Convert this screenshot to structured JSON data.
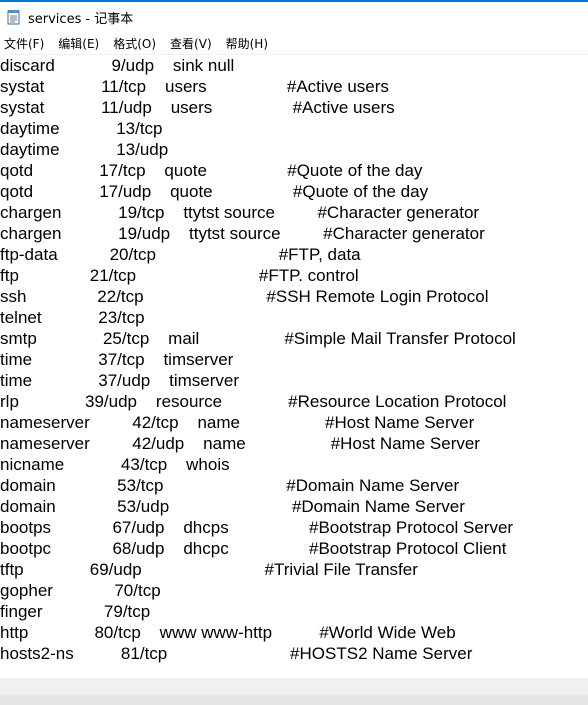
{
  "window": {
    "title": "services - 记事本"
  },
  "menu": {
    "file": "文件(F)",
    "edit": "编辑(E)",
    "format": "格式(O)",
    "view": "查看(V)",
    "help": "帮助(H)"
  },
  "icons": {
    "app": "notepad-icon"
  },
  "editor": {
    "lines": [
      "discard            9/udp    sink null",
      "systat            11/tcp    users                 #Active users",
      "systat            11/udp    users                 #Active users",
      "daytime            13/tcp",
      "daytime            13/udp",
      "qotd              17/tcp    quote                 #Quote of the day",
      "qotd              17/udp    quote                 #Quote of the day",
      "chargen            19/tcp    ttytst source         #Character generator",
      "chargen            19/udp    ttytst source         #Character generator",
      "ftp-data           20/tcp                          #FTP, data",
      "ftp               21/tcp                          #FTP. control",
      "ssh               22/tcp                          #SSH Remote Login Protocol",
      "telnet            23/tcp",
      "smtp              25/tcp    mail                  #Simple Mail Transfer Protocol",
      "time              37/tcp    timserver",
      "time              37/udp    timserver",
      "rlp              39/udp    resource              #Resource Location Protocol",
      "nameserver         42/tcp    name                  #Host Name Server",
      "nameserver         42/udp    name                  #Host Name Server",
      "nicname            43/tcp    whois",
      "domain             53/tcp                          #Domain Name Server",
      "domain             53/udp                          #Domain Name Server",
      "bootps             67/udp    dhcps                 #Bootstrap Protocol Server",
      "bootpc             68/udp    dhcpc                 #Bootstrap Protocol Client",
      "tftp              69/udp                          #Trivial File Transfer",
      "gopher             70/tcp",
      "finger             79/tcp",
      "http              80/tcp    www www-http          #World Wide Web",
      "hosts2-ns          81/tcp                          #HOSTS2 Name Server"
    ]
  }
}
